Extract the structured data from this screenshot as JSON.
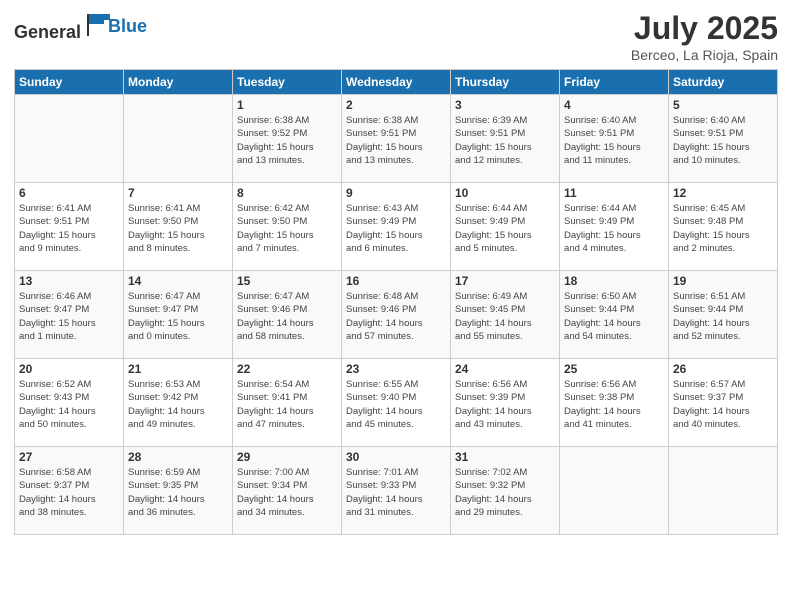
{
  "header": {
    "logo_general": "General",
    "logo_blue": "Blue",
    "month": "July 2025",
    "location": "Berceo, La Rioja, Spain"
  },
  "days_of_week": [
    "Sunday",
    "Monday",
    "Tuesday",
    "Wednesday",
    "Thursday",
    "Friday",
    "Saturday"
  ],
  "weeks": [
    [
      {
        "day": "",
        "info": ""
      },
      {
        "day": "",
        "info": ""
      },
      {
        "day": "1",
        "info": "Sunrise: 6:38 AM\nSunset: 9:52 PM\nDaylight: 15 hours\nand 13 minutes."
      },
      {
        "day": "2",
        "info": "Sunrise: 6:38 AM\nSunset: 9:51 PM\nDaylight: 15 hours\nand 13 minutes."
      },
      {
        "day": "3",
        "info": "Sunrise: 6:39 AM\nSunset: 9:51 PM\nDaylight: 15 hours\nand 12 minutes."
      },
      {
        "day": "4",
        "info": "Sunrise: 6:40 AM\nSunset: 9:51 PM\nDaylight: 15 hours\nand 11 minutes."
      },
      {
        "day": "5",
        "info": "Sunrise: 6:40 AM\nSunset: 9:51 PM\nDaylight: 15 hours\nand 10 minutes."
      }
    ],
    [
      {
        "day": "6",
        "info": "Sunrise: 6:41 AM\nSunset: 9:51 PM\nDaylight: 15 hours\nand 9 minutes."
      },
      {
        "day": "7",
        "info": "Sunrise: 6:41 AM\nSunset: 9:50 PM\nDaylight: 15 hours\nand 8 minutes."
      },
      {
        "day": "8",
        "info": "Sunrise: 6:42 AM\nSunset: 9:50 PM\nDaylight: 15 hours\nand 7 minutes."
      },
      {
        "day": "9",
        "info": "Sunrise: 6:43 AM\nSunset: 9:49 PM\nDaylight: 15 hours\nand 6 minutes."
      },
      {
        "day": "10",
        "info": "Sunrise: 6:44 AM\nSunset: 9:49 PM\nDaylight: 15 hours\nand 5 minutes."
      },
      {
        "day": "11",
        "info": "Sunrise: 6:44 AM\nSunset: 9:49 PM\nDaylight: 15 hours\nand 4 minutes."
      },
      {
        "day": "12",
        "info": "Sunrise: 6:45 AM\nSunset: 9:48 PM\nDaylight: 15 hours\nand 2 minutes."
      }
    ],
    [
      {
        "day": "13",
        "info": "Sunrise: 6:46 AM\nSunset: 9:47 PM\nDaylight: 15 hours\nand 1 minute."
      },
      {
        "day": "14",
        "info": "Sunrise: 6:47 AM\nSunset: 9:47 PM\nDaylight: 15 hours\nand 0 minutes."
      },
      {
        "day": "15",
        "info": "Sunrise: 6:47 AM\nSunset: 9:46 PM\nDaylight: 14 hours\nand 58 minutes."
      },
      {
        "day": "16",
        "info": "Sunrise: 6:48 AM\nSunset: 9:46 PM\nDaylight: 14 hours\nand 57 minutes."
      },
      {
        "day": "17",
        "info": "Sunrise: 6:49 AM\nSunset: 9:45 PM\nDaylight: 14 hours\nand 55 minutes."
      },
      {
        "day": "18",
        "info": "Sunrise: 6:50 AM\nSunset: 9:44 PM\nDaylight: 14 hours\nand 54 minutes."
      },
      {
        "day": "19",
        "info": "Sunrise: 6:51 AM\nSunset: 9:44 PM\nDaylight: 14 hours\nand 52 minutes."
      }
    ],
    [
      {
        "day": "20",
        "info": "Sunrise: 6:52 AM\nSunset: 9:43 PM\nDaylight: 14 hours\nand 50 minutes."
      },
      {
        "day": "21",
        "info": "Sunrise: 6:53 AM\nSunset: 9:42 PM\nDaylight: 14 hours\nand 49 minutes."
      },
      {
        "day": "22",
        "info": "Sunrise: 6:54 AM\nSunset: 9:41 PM\nDaylight: 14 hours\nand 47 minutes."
      },
      {
        "day": "23",
        "info": "Sunrise: 6:55 AM\nSunset: 9:40 PM\nDaylight: 14 hours\nand 45 minutes."
      },
      {
        "day": "24",
        "info": "Sunrise: 6:56 AM\nSunset: 9:39 PM\nDaylight: 14 hours\nand 43 minutes."
      },
      {
        "day": "25",
        "info": "Sunrise: 6:56 AM\nSunset: 9:38 PM\nDaylight: 14 hours\nand 41 minutes."
      },
      {
        "day": "26",
        "info": "Sunrise: 6:57 AM\nSunset: 9:37 PM\nDaylight: 14 hours\nand 40 minutes."
      }
    ],
    [
      {
        "day": "27",
        "info": "Sunrise: 6:58 AM\nSunset: 9:37 PM\nDaylight: 14 hours\nand 38 minutes."
      },
      {
        "day": "28",
        "info": "Sunrise: 6:59 AM\nSunset: 9:35 PM\nDaylight: 14 hours\nand 36 minutes."
      },
      {
        "day": "29",
        "info": "Sunrise: 7:00 AM\nSunset: 9:34 PM\nDaylight: 14 hours\nand 34 minutes."
      },
      {
        "day": "30",
        "info": "Sunrise: 7:01 AM\nSunset: 9:33 PM\nDaylight: 14 hours\nand 31 minutes."
      },
      {
        "day": "31",
        "info": "Sunrise: 7:02 AM\nSunset: 9:32 PM\nDaylight: 14 hours\nand 29 minutes."
      },
      {
        "day": "",
        "info": ""
      },
      {
        "day": "",
        "info": ""
      }
    ]
  ]
}
